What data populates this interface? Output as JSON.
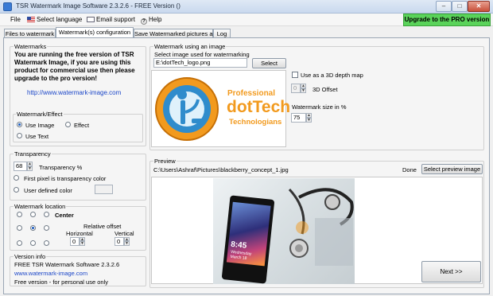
{
  "window": {
    "title": "TSR Watermark Image Software 2.3.2.6 - FREE Version ()"
  },
  "menu": {
    "file": "File",
    "select_language": "Select language",
    "email_support": "Email support",
    "help": "Help",
    "upgrade": "Upgrade to the PRO version"
  },
  "tabs": [
    {
      "label": "Files to watermark"
    },
    {
      "label": "Watermark(s) configuration"
    },
    {
      "label": "Save Watermarked pictures as"
    },
    {
      "label": "Log"
    }
  ],
  "watermarks": {
    "title": "Watermarks",
    "notice": "You are running the free version of TSR Watermark Image, if you are using this product for commercial use then please upgrade to the pro version!",
    "url": "http://www.watermark-image.com"
  },
  "effect": {
    "title": "Watermark/Effect",
    "use_image": "Use Image",
    "effect": "Effect",
    "use_text": "Use Text"
  },
  "transparency": {
    "title": "Transparency",
    "value": "68",
    "percent_label": "Transparency %",
    "first_pixel": "First pixel is transparency color",
    "user_defined": "User defined color"
  },
  "location": {
    "title": "Watermark location",
    "center": "Center",
    "relative_offset": "Relative offset",
    "horizontal": "Horizontal",
    "vertical": "Vertical",
    "horizontal_value": "0",
    "vertical_value": "0"
  },
  "version_info": {
    "title": "Version info",
    "line1": "FREE TSR Watermark Software 2.3.2.6",
    "line2": "www.watermark-image.com",
    "line3": "Free version - for personal use only"
  },
  "image_wm": {
    "title": "Watermark using an image",
    "select_label": "Select image used for watermarking",
    "path": "E:\\dotTech_logo.png",
    "select_button": "Select",
    "depth_map": "Use as a 3D depth map",
    "offset_value": "0",
    "offset_label": "3D Offset",
    "size_label": "Watermark size in %",
    "size_value": "75",
    "logo_line1": "Professional",
    "logo_line2": "dotTech",
    "logo_line3": "Technologians"
  },
  "preview": {
    "title": "Preview",
    "path": "C:\\Users\\Ashraf\\Pictures\\blackberry_concept_1.jpg",
    "status": "Done",
    "select_button": "Select preview image",
    "phone_time": "8:45",
    "phone_day": "Wednesday",
    "phone_date": "March 18"
  },
  "next_button": "Next >>",
  "colors": {
    "upgrade_bg": "#5ad35a",
    "link": "#1b46c8",
    "logo_orange": "#f29a1e"
  }
}
